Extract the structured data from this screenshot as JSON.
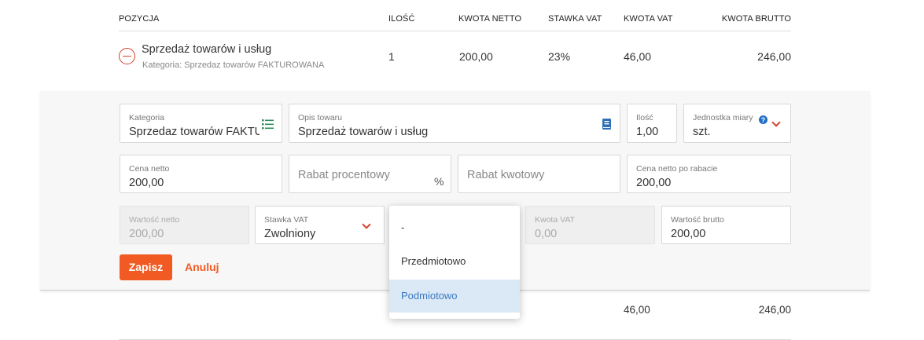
{
  "table": {
    "headers": {
      "position": "POZYCJA",
      "quantity": "ILOŚĆ",
      "net_amount": "KWOTA NETTO",
      "vat_rate": "STAWKA VAT",
      "vat_amount": "KWOTA VAT",
      "gross_amount": "KWOTA BRUTTO"
    },
    "row": {
      "name": "Sprzedaż towarów i usług",
      "category": "Kategoria: Sprzedaz towarów FAKTUROWANA",
      "quantity": "1",
      "net_amount": "200,00",
      "vat_rate": "23%",
      "vat_amount": "46,00",
      "gross_amount": "246,00"
    },
    "totals": {
      "vat_amount": "46,00",
      "gross_amount": "246,00"
    }
  },
  "form": {
    "category": {
      "label": "Kategoria",
      "value": "Sprzedaz towarów FAKTUROWANA"
    },
    "description": {
      "label": "Opis towaru",
      "value": "Sprzedaż towarów i usług"
    },
    "quantity": {
      "label": "Ilość",
      "value": "1,00"
    },
    "unit": {
      "label": "Jednostka miary",
      "value": "szt."
    },
    "net_price": {
      "label": "Cena netto",
      "value": "200,00"
    },
    "discount_percent": {
      "placeholder": "Rabat procentowy",
      "suffix": "%"
    },
    "discount_amount": {
      "placeholder": "Rabat kwotowy"
    },
    "net_after_discount": {
      "label": "Cena netto po rabacie",
      "value": "200,00"
    },
    "net_value": {
      "label": "Wartość netto",
      "value": "200,00"
    },
    "vat_rate": {
      "label": "Stawka VAT",
      "value": "Zwolniony"
    },
    "vat_amount": {
      "label": "Kwota VAT",
      "value": "0,00"
    },
    "gross_value": {
      "label": "Wartość brutto",
      "value": "200,00"
    },
    "save_label": "Zapisz",
    "cancel_label": "Anuluj"
  },
  "dropdown": {
    "options": [
      "-",
      "Przedmiotowo",
      "Podmiotowo"
    ],
    "selected": "Podmiotowo"
  },
  "colors": {
    "accent": "#f15a22",
    "remove": "#d7402b",
    "selected_bg": "#dbe8f6",
    "selected_text": "#3a79c1",
    "list_icon": "#2e8b57",
    "book_icon": "#2f6fb3",
    "help_icon": "#1f6fc6"
  }
}
